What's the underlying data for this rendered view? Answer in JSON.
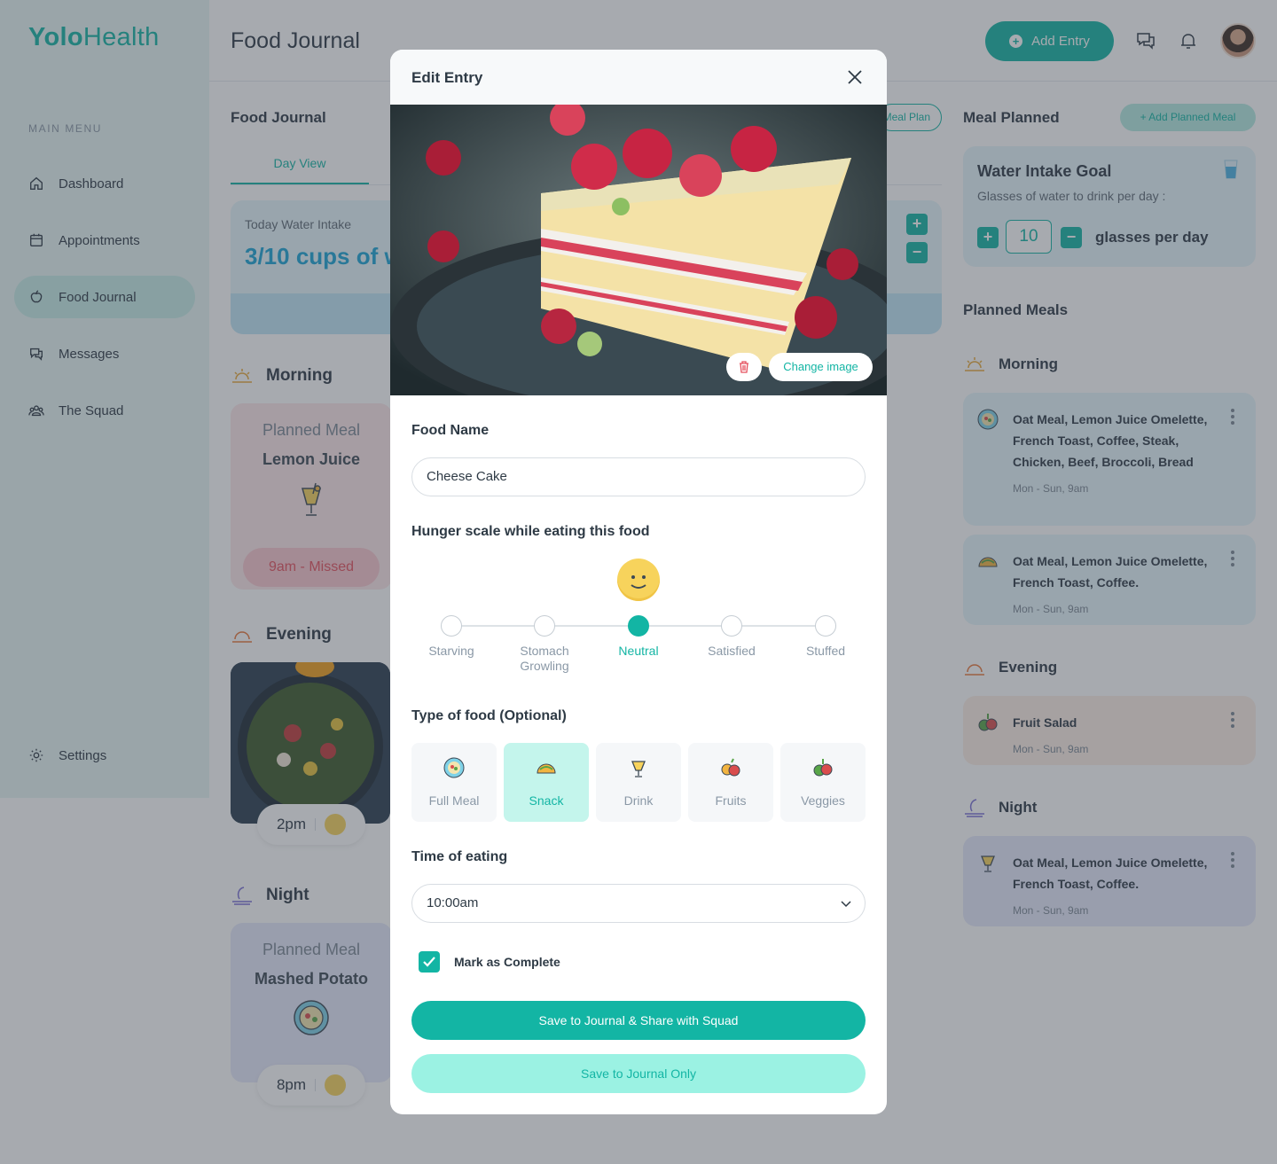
{
  "app": {
    "logo_bold": "Yolo",
    "logo_light": "Health"
  },
  "sidebar": {
    "menu_title": "MAIN MENU",
    "items": [
      {
        "label": "Dashboard",
        "icon": "home-icon"
      },
      {
        "label": "Appointments",
        "icon": "calendar-icon"
      },
      {
        "label": "Food Journal",
        "icon": "apple-icon",
        "active": true
      },
      {
        "label": "Messages",
        "icon": "chat-icon"
      },
      {
        "label": "The Squad",
        "icon": "group-icon"
      }
    ],
    "settings_label": "Settings"
  },
  "header": {
    "title": "Food Journal",
    "add_entry_label": "Add Entry"
  },
  "journal": {
    "section_title": "Food Journal",
    "tab_label": "Day View",
    "meal_plan_pill": "Meal Plan",
    "water_label": "Today Water Intake",
    "water_value": "3/10 cups of water",
    "periods": {
      "morning": "Morning",
      "evening": "Evening",
      "night": "Night"
    },
    "morning_card": {
      "heading": "Planned Meal",
      "name": "Lemon Juice",
      "status": "9am - Missed"
    },
    "evening_card": {
      "time": "2pm"
    },
    "night_card": {
      "heading": "Planned Meal",
      "name": "Mashed Potato",
      "time": "8pm"
    }
  },
  "meal_planned": {
    "title": "Meal Planned",
    "add_label": "Add Planned Meal",
    "goal": {
      "title": "Water Intake Goal",
      "subtitle": "Glasses of water to drink per day :",
      "value": "10",
      "unit": "glasses per day"
    },
    "planned_title": "Planned Meals",
    "morning_label": "Morning",
    "evening_label": "Evening",
    "night_label": "Night",
    "cards": [
      {
        "text": "Oat Meal, Lemon Juice Omelette, French Toast, Coffee, Steak, Chicken, Beef, Broccoli, Bread",
        "time": "Mon - Sun, 9am",
        "icon": "salad-bowl-icon"
      },
      {
        "text": "Oat Meal, Lemon Juice Omelette, French Toast, Coffee.",
        "time": "Mon - Sun, 9am",
        "icon": "taco-icon"
      },
      {
        "text": "Fruit Salad",
        "time": "Mon - Sun, 9am",
        "icon": "veggies-icon"
      },
      {
        "text": "Oat Meal, Lemon Juice Omelette, French Toast, Coffee.",
        "time": "Mon - Sun, 9am",
        "icon": "drink-icon"
      }
    ]
  },
  "modal": {
    "title": "Edit Entry",
    "change_image_label": "Change image",
    "food_name_label": "Food Name",
    "food_name_value": "Cheese Cake",
    "hunger_label": "Hunger scale while eating this food",
    "hunger_scale": [
      "Starving",
      "Stomach Growling",
      "Neutral",
      "Satisfied",
      "Stuffed"
    ],
    "hunger_selected": "Neutral",
    "type_label": "Type of food (Optional)",
    "types": [
      {
        "label": "Full Meal",
        "icon": "salad-bowl-icon"
      },
      {
        "label": "Snack",
        "icon": "taco-icon"
      },
      {
        "label": "Drink",
        "icon": "drink-icon"
      },
      {
        "label": "Fruits",
        "icon": "fruits-icon"
      },
      {
        "label": "Veggies",
        "icon": "veggies-icon"
      }
    ],
    "type_selected": "Snack",
    "time_label": "Time of eating",
    "time_value": "10:00am",
    "complete_label": "Mark as Complete",
    "complete_checked": true,
    "primary_button": "Save to Journal & Share with Squad",
    "secondary_button": "Save to Journal Only"
  },
  "colors": {
    "accent": "#13b5a4",
    "accent_light": "#9bf2e3",
    "missed": "#e5505e"
  }
}
